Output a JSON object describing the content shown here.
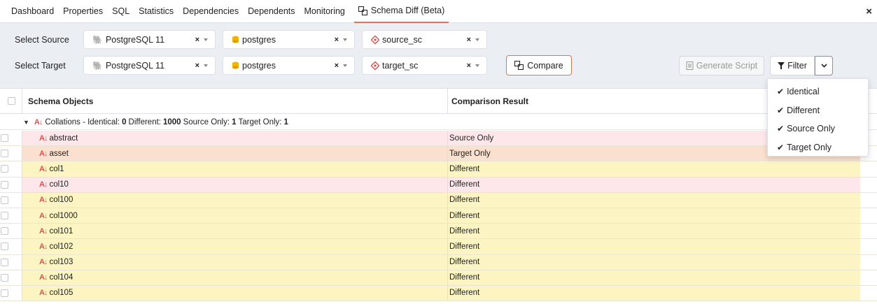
{
  "tabs": [
    "Dashboard",
    "Properties",
    "SQL",
    "Statistics",
    "Dependencies",
    "Dependents",
    "Monitoring"
  ],
  "active_tab": "Schema Diff (Beta)",
  "close_label": "×",
  "source": {
    "label": "Select Source",
    "server": "PostgreSQL 11",
    "database": "postgres",
    "schema": "source_sc"
  },
  "target": {
    "label": "Select Target",
    "server": "PostgreSQL 11",
    "database": "postgres",
    "schema": "target_sc"
  },
  "clear_glyph": "×",
  "buttons": {
    "compare": "Compare",
    "generate_script": "Generate Script",
    "filter": "Filter"
  },
  "grid": {
    "col_objects": "Schema Objects",
    "col_result": "Comparison Result"
  },
  "group": {
    "prefix": "Collations - Identical:",
    "identical": "0",
    "different_label": "Different:",
    "different": "1000",
    "source_only_label": "Source Only:",
    "source_only": "1",
    "target_only_label": "Target Only:",
    "target_only": "1"
  },
  "rows": [
    {
      "name": "abstract",
      "result": "Source Only",
      "kind": "src"
    },
    {
      "name": "asset",
      "result": "Target Only",
      "kind": "tgt"
    },
    {
      "name": "col1",
      "result": "Different",
      "kind": "diff"
    },
    {
      "name": "col10",
      "result": "Different",
      "kind": "diff-pink"
    },
    {
      "name": "col100",
      "result": "Different",
      "kind": "diff"
    },
    {
      "name": "col1000",
      "result": "Different",
      "kind": "diff"
    },
    {
      "name": "col101",
      "result": "Different",
      "kind": "diff"
    },
    {
      "name": "col102",
      "result": "Different",
      "kind": "diff"
    },
    {
      "name": "col103",
      "result": "Different",
      "kind": "diff"
    },
    {
      "name": "col104",
      "result": "Different",
      "kind": "diff"
    },
    {
      "name": "col105",
      "result": "Different",
      "kind": "diff"
    }
  ],
  "filter_options": [
    "Identical",
    "Different",
    "Source Only",
    "Target Only"
  ],
  "colors": {
    "accent": "#e0744b",
    "source_only_bg": "#fde7ea",
    "target_only_bg": "#fae0ce",
    "different_bg": "#fcf4c2",
    "panel_bg": "#ebeef3"
  }
}
